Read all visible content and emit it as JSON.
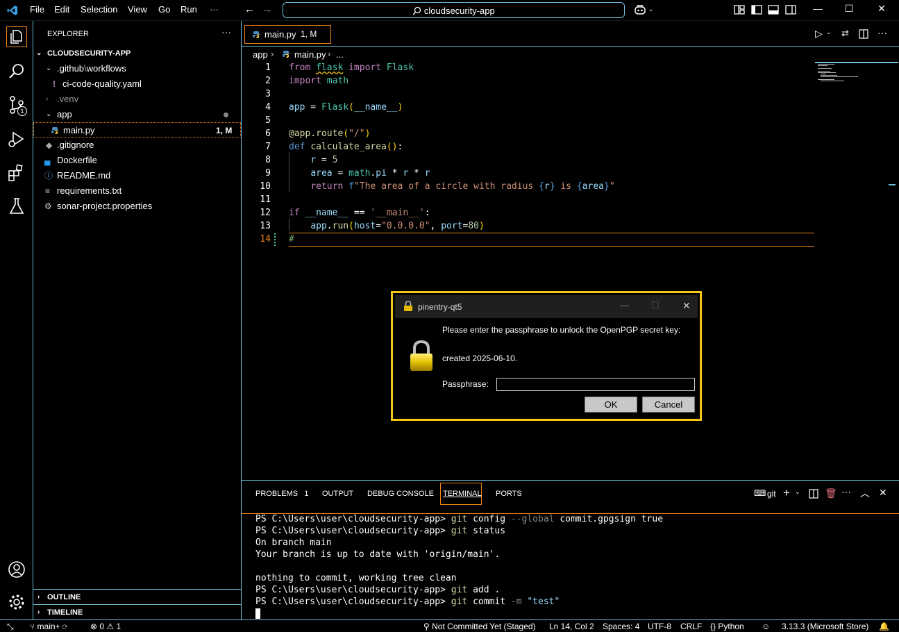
{
  "titlebar": {
    "menu": [
      "File",
      "Edit",
      "Selection",
      "View",
      "Go",
      "Run",
      "···"
    ],
    "search_text": "cloudsecurity-app"
  },
  "activity": {
    "scm_badge": "1"
  },
  "sidebar": {
    "title": "EXPLORER",
    "root": "CLOUDSECURITY-APP",
    "items": [
      {
        "label": ".github",
        "label2": "workflows",
        "sep": "\\"
      },
      {
        "label": "ci-code-quality.yaml",
        "icon": "!"
      },
      {
        "label": ".venv"
      },
      {
        "label": "app"
      },
      {
        "label": "main.py",
        "status": "1, M"
      },
      {
        "label": ".gitignore"
      },
      {
        "label": "Dockerfile"
      },
      {
        "label": "README.md"
      },
      {
        "label": "requirements.txt"
      },
      {
        "label": "sonar-project.properties"
      }
    ],
    "outline": "OUTLINE",
    "timeline": "TIMELINE"
  },
  "editor": {
    "tab_label": "main.py",
    "tab_status": "1, M",
    "breadcrumb": [
      "app",
      "main.py",
      "..."
    ],
    "line_numbers": [
      "1",
      "2",
      "3",
      "4",
      "5",
      "6",
      "7",
      "8",
      "9",
      "10",
      "11",
      "12",
      "13",
      "14"
    ]
  },
  "dialog": {
    "title": "pinentry-qt5",
    "message": "Please enter the passphrase to unlock the OpenPGP secret key:",
    "created": "created 2025-06-10.",
    "passphrase_label": "Passphrase:",
    "passphrase_value": "",
    "ok": "OK",
    "cancel": "Cancel"
  },
  "panel": {
    "tabs": [
      "PROBLEMS",
      "OUTPUT",
      "DEBUG CONSOLE",
      "TERMINAL",
      "PORTS"
    ],
    "problems_count": "1",
    "terminal_name": "git",
    "terminal": [
      {
        "prompt": "PS C:\\Users\\user\\cloudsecurity-app> ",
        "cmd": "git",
        "rest": " config ",
        "flag": "--global",
        "rest2": " commit.gpgsign true"
      },
      {
        "prompt": "PS C:\\Users\\user\\cloudsecurity-app> ",
        "cmd": "git",
        "rest": " status"
      },
      {
        "text": "On branch main"
      },
      {
        "text": "Your branch is up to date with 'origin/main'."
      },
      {
        "text": ""
      },
      {
        "text": "nothing to commit, working tree clean"
      },
      {
        "prompt": "PS C:\\Users\\user\\cloudsecurity-app> ",
        "cmd": "git",
        "rest": " add ."
      },
      {
        "prompt": "PS C:\\Users\\user\\cloudsecurity-app> ",
        "cmd": "git",
        "rest": " commit ",
        "flag": "-m",
        "str": " \"test\""
      }
    ]
  },
  "statusbar": {
    "branch": "main+",
    "errors": "0",
    "warnings": "1",
    "blame": "Not Committed Yet (Staged)",
    "position": "Ln 14, Col 2",
    "spaces": "Spaces: 4",
    "encoding": "UTF-8",
    "eol": "CRLF",
    "language": "Python",
    "interpreter": "3.13.3 (Microsoft Store)"
  },
  "colors": {
    "accent_border": "#6fc3df",
    "focus_orange": "#f38518",
    "dialog_border": "#f5c518"
  }
}
